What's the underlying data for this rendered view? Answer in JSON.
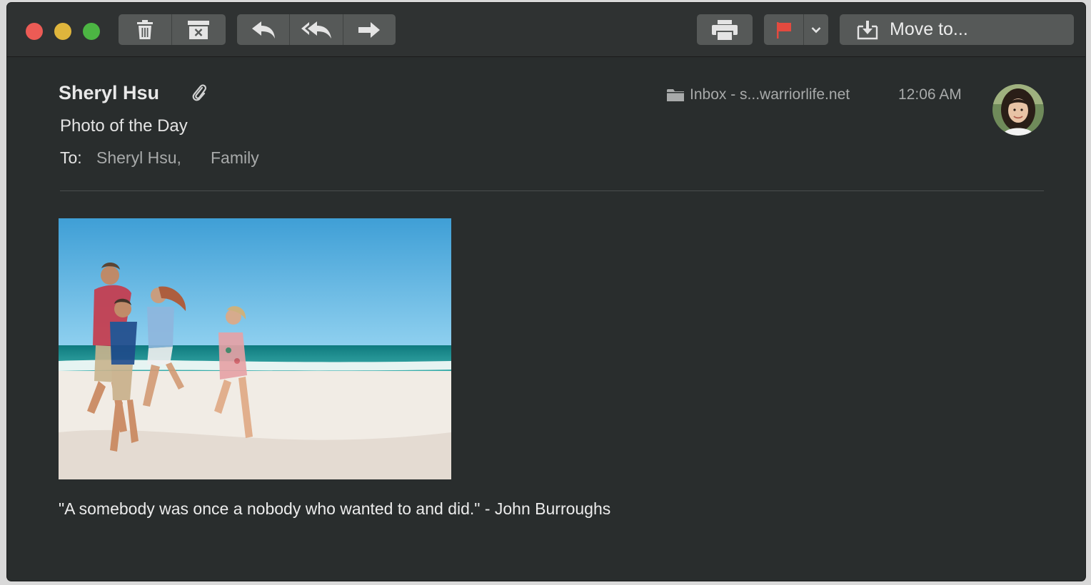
{
  "toolbar": {
    "buttons": [
      "trash-icon",
      "archive-icon",
      "reply-icon",
      "reply-all-icon",
      "forward-icon",
      "print-icon",
      "flag-icon",
      "chevron-down-icon",
      "move-icon"
    ],
    "move_label": "Move to...",
    "flag_color": "#e34a3f"
  },
  "message": {
    "from": "Sheryl Hsu",
    "subject": "Photo of the Day",
    "to_label": "To:",
    "recipients": [
      "Sheryl Hsu,",
      "Family"
    ],
    "mailbox": "Inbox - s...warriorlife.net",
    "time": "12:06 AM",
    "body": "\"A somebody was once a nobody who wanted to and did.\" - John Burroughs"
  },
  "colors": {
    "background": "#292d2d",
    "toolbar": "#2f3232",
    "button": "#565958",
    "text": "#e8e8e8",
    "secondary_text": "#a8aaaa"
  }
}
